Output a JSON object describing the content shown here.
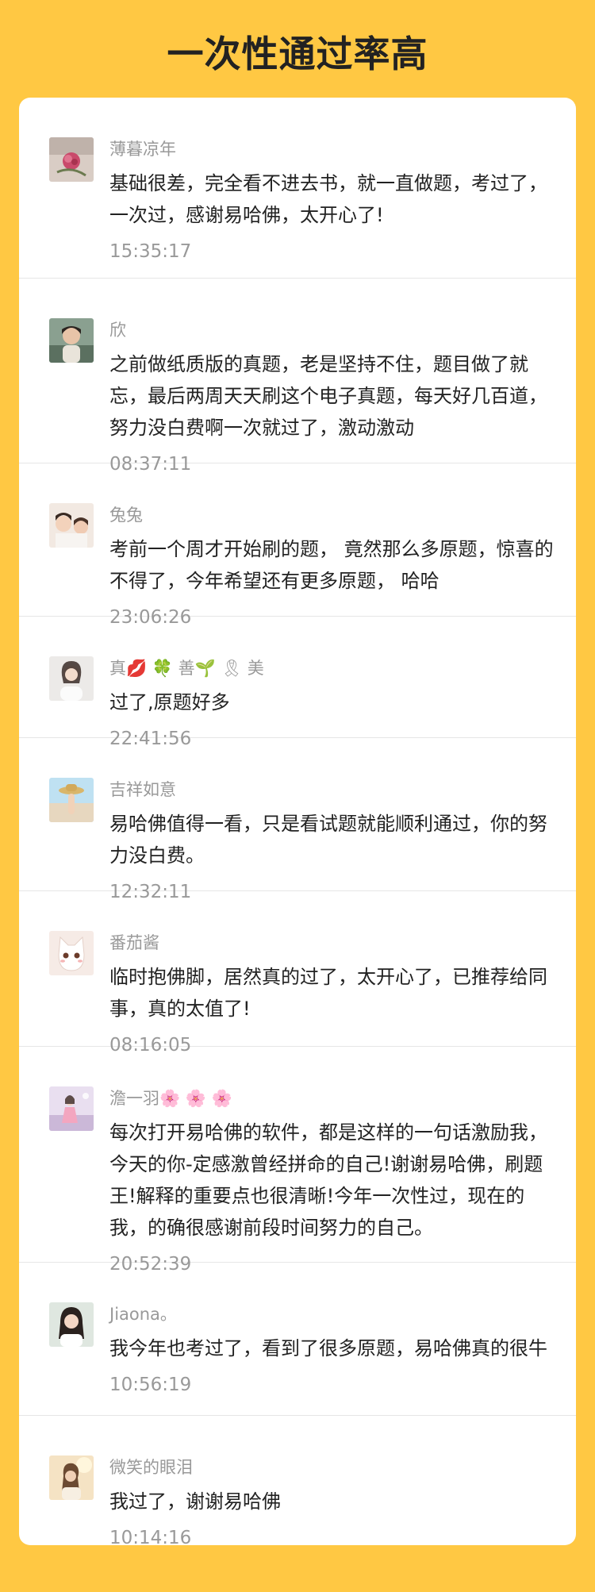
{
  "page": {
    "title": "一次性通过率高",
    "colors": {
      "background": "#FFC843",
      "card": "#ffffff",
      "username": "#999999",
      "comment": "#222222",
      "time": "#999999"
    }
  },
  "reviews": [
    {
      "avatar": "avatar-flower-image",
      "username": "薄暮凉年",
      "comment": "基础很差，完全看不进去书，就一直做题，考过了，一次过，感谢易哈佛，太开心了!",
      "time": "15:35:17"
    },
    {
      "avatar": "avatar-woman-photo",
      "username": "欣",
      "comment": "之前做纸质版的真题，老是坚持不住，题目做了就忘，最后两周天天刷这个电子真题，每天好几百道，努力没白费啊一次就过了，激动激动",
      "time": "08:37:11"
    },
    {
      "avatar": "avatar-child-photo",
      "username": "兔兔",
      "comment": "考前一个周才开始刷的题， 竟然那么多原题，惊喜的不得了，今年希望还有更多原题， 哈哈",
      "time": "23:06:26"
    },
    {
      "avatar": "avatar-woman-portrait",
      "username": "真💋 🍀 善🌱 🎗 美",
      "comment": "过了,原题好多",
      "time": "22:41:56"
    },
    {
      "avatar": "avatar-hat-photo",
      "username": "吉祥如意",
      "comment": "易哈佛值得一看，只是看试题就能顺利通过，你的努力没白费。",
      "time": "12:32:11"
    },
    {
      "avatar": "avatar-cartoon-cat",
      "username": "番茄酱",
      "comment": "临时抱佛脚，居然真的过了，太开心了，已推荐给同事，真的太值了!",
      "time": "08:16:05"
    },
    {
      "avatar": "avatar-pink-scene",
      "username": "澹一羽🌸 🌸 🌸",
      "comment": "每次打开易哈佛的软件，都是这样的一句话激励我，今天的你-定感激曾经拼命的自己!谢谢易哈佛，刷题王!解释的重要点也很清晰!今年一次性过，现在的我，的确很感谢前段时间努力的自己。",
      "time": "20:52:39"
    },
    {
      "avatar": "avatar-woman-smile",
      "username": "Jiaona。",
      "comment": "我今年也考过了，看到了很多原题，易哈佛真的很牛",
      "time": "10:56:19"
    },
    {
      "avatar": "avatar-sunlight-photo",
      "username": "微笑的眼泪",
      "comment": "我过了，谢谢易哈佛",
      "time": "10:14:16"
    }
  ]
}
